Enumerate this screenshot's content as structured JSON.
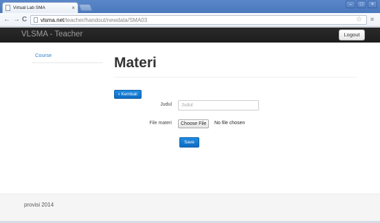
{
  "browser": {
    "tab_title": "Virtual Lab SMA",
    "tab_close": "×",
    "url_host": "vlsma.net",
    "url_path": "/teacher/handout/newdata/SMA03",
    "back_glyph": "←",
    "forward_glyph": "→",
    "reload_glyph": "C",
    "star_glyph": "☆",
    "window_min": "–",
    "window_max": "□",
    "window_close": "×"
  },
  "navbar": {
    "brand": "VLSMA - Teacher",
    "logout_label": "Logout"
  },
  "sidebar": {
    "items": [
      {
        "label": "Course"
      }
    ]
  },
  "main": {
    "title": "Materi",
    "back_label": "Kembali",
    "form": {
      "judul_label": "Judul",
      "judul_placeholder": "Judul",
      "judul_value": "",
      "file_label": "File materi",
      "choose_file_label": "Choose File",
      "no_file_text": "No file chosen",
      "save_label": "Save"
    }
  },
  "footer": {
    "text": "provisi 2014"
  },
  "colors": {
    "navbar_bg": "#222222",
    "link": "#2a7fd0",
    "primary_button": "#1577d0",
    "browser_frame": "#4f7fc4"
  }
}
